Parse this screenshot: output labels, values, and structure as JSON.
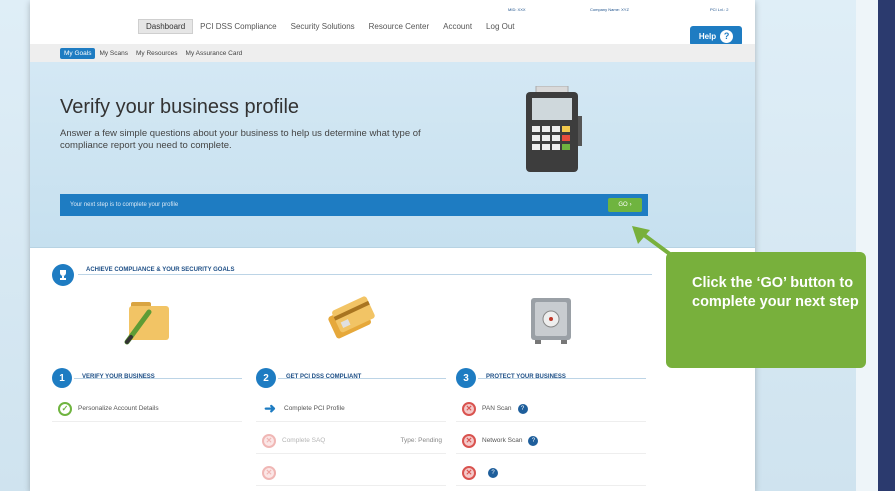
{
  "top_meta": {
    "mid": "MID: XXX",
    "company": "Company Name: XYZ",
    "level": "PCI Lvl.: 2"
  },
  "nav": {
    "items": [
      "Dashboard",
      "PCI DSS Compliance",
      "Security Solutions",
      "Resource Center",
      "Account",
      "Log Out"
    ],
    "active": "Dashboard"
  },
  "help": {
    "label": "Help",
    "icon": "?"
  },
  "subnav": {
    "tabs": [
      "My Goals",
      "My Scans",
      "My Resources",
      "My Assurance Card"
    ],
    "active": "My Goals"
  },
  "hero": {
    "title": "Verify your business profile",
    "subtitle": "Answer a few simple questions about your business to help us determine what type of compliance report you need to complete.",
    "bar_text": "Your next step is to complete your profile",
    "go_label": "GO",
    "go_arrow": "›"
  },
  "section": {
    "title": "ACHIEVE COMPLIANCE & YOUR SECURITY GOALS"
  },
  "steps": [
    {
      "number": "1",
      "title": "VERIFY YOUR BUSINESS",
      "tasks": [
        {
          "label": "Personalize Account Details",
          "status": "done"
        }
      ]
    },
    {
      "number": "2",
      "title": "GET PCI DSS COMPLIANT",
      "tasks": [
        {
          "label": "Complete PCI Profile",
          "status": "next"
        },
        {
          "label": "Complete SAQ",
          "status": "dim",
          "extra": "Type: Pending"
        },
        {
          "label": "",
          "status": "dim"
        }
      ]
    },
    {
      "number": "3",
      "title": "PROTECT YOUR BUSINESS",
      "tasks": [
        {
          "label": "PAN Scan",
          "status": "fail",
          "help": true
        },
        {
          "label": "Network Scan",
          "status": "fail",
          "help": true
        },
        {
          "label": "",
          "status": "fail",
          "help": true
        }
      ]
    }
  ],
  "callout": {
    "text": "Click the ‘GO’ button to complete your next step"
  },
  "colors": {
    "brand_blue": "#1e7cc2",
    "go_green": "#6fb43f",
    "callout_green": "#78b03c",
    "navy": "#2b3a6e"
  }
}
